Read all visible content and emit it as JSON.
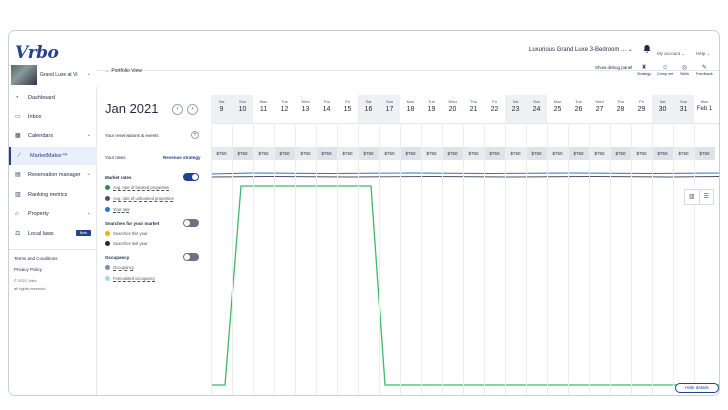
{
  "header": {
    "logo": "Vrbo",
    "property_select": "Luxurious Grand Luxe 3-Bedroom ...",
    "account": "My account",
    "help": "Help",
    "bell_icon": "bell-icon"
  },
  "sidebar": {
    "property_name": "Grand Luxe at Vi",
    "items": [
      {
        "label": "Dashboard",
        "icon": "dashboard-icon"
      },
      {
        "label": "Inbox",
        "icon": "inbox-icon"
      },
      {
        "label": "Calendars",
        "icon": "calendar-icon"
      },
      {
        "label": "MarketMaker™",
        "icon": "chart-icon"
      },
      {
        "label": "Reservation manager",
        "icon": "reservation-icon"
      },
      {
        "label": "Ranking metrics",
        "icon": "ranking-icon"
      },
      {
        "label": "Property",
        "icon": "home-icon"
      },
      {
        "label": "Local laws",
        "icon": "scale-icon",
        "badge": "Beta"
      }
    ],
    "footer": {
      "terms": "Terms and Conditions",
      "privacy": "Privacy Policy",
      "copyright": "© 2021 Vrbo,",
      "rights": "all rights reserved"
    }
  },
  "toolbar": {
    "back_link": "Portfolio View",
    "debug": "Show debug panel",
    "tools": [
      {
        "label": "Strategy",
        "icon": "strategy-icon"
      },
      {
        "label": "Comp set",
        "icon": "comp-set-icon"
      },
      {
        "label": "Skills",
        "icon": "skills-icon"
      },
      {
        "label": "Feedback",
        "icon": "feedback-icon"
      }
    ]
  },
  "panel": {
    "month": "Jan 2021",
    "reservations": "Your reservations & events",
    "rates": "Your rates",
    "revenue": "Revenue strategy",
    "market_rates": {
      "title": "Market rates",
      "items": [
        {
          "label": "Avg. rate of booked properties",
          "color": "#2e8b57"
        },
        {
          "label": "Avg. rate of unbooked properties",
          "color": "#4a5163"
        },
        {
          "label": "Your rate",
          "color": "#2f6fd6"
        }
      ]
    },
    "searches": {
      "title": "Searches for your market",
      "items": [
        {
          "label": "Searches this year",
          "color": "#e7b400"
        },
        {
          "label": "Searches last year",
          "color": "#1f2a44"
        }
      ]
    },
    "occupancy": {
      "title": "Occupancy",
      "items": [
        {
          "label": "Occupancy",
          "color": "#7e8bb8"
        },
        {
          "label": "Forecasted occupancy",
          "color": "#a9d6ea"
        }
      ]
    }
  },
  "calendar": {
    "days": [
      {
        "dow": "Sat",
        "num": "9"
      },
      {
        "dow": "Sun",
        "num": "10"
      },
      {
        "dow": "Mon",
        "num": "11"
      },
      {
        "dow": "Tue",
        "num": "12"
      },
      {
        "dow": "Wed",
        "num": "13"
      },
      {
        "dow": "Thu",
        "num": "14"
      },
      {
        "dow": "Fri",
        "num": "15"
      },
      {
        "dow": "Sat",
        "num": "16"
      },
      {
        "dow": "Sun",
        "num": "17"
      },
      {
        "dow": "Mon",
        "num": "18"
      },
      {
        "dow": "Tue",
        "num": "19"
      },
      {
        "dow": "Wed",
        "num": "20"
      },
      {
        "dow": "Thu",
        "num": "21"
      },
      {
        "dow": "Fri",
        "num": "22"
      },
      {
        "dow": "Sat",
        "num": "23"
      },
      {
        "dow": "Sun",
        "num": "24"
      },
      {
        "dow": "Mon",
        "num": "25"
      },
      {
        "dow": "Tue",
        "num": "26"
      },
      {
        "dow": "Wed",
        "num": "27"
      },
      {
        "dow": "Thu",
        "num": "28"
      },
      {
        "dow": "Fri",
        "num": "29"
      },
      {
        "dow": "Sat",
        "num": "30"
      },
      {
        "dow": "Sun",
        "num": "31"
      },
      {
        "dow": "Mon",
        "num": "Feb 1"
      }
    ],
    "rate": "$750",
    "hide_details": "Hide details"
  }
}
